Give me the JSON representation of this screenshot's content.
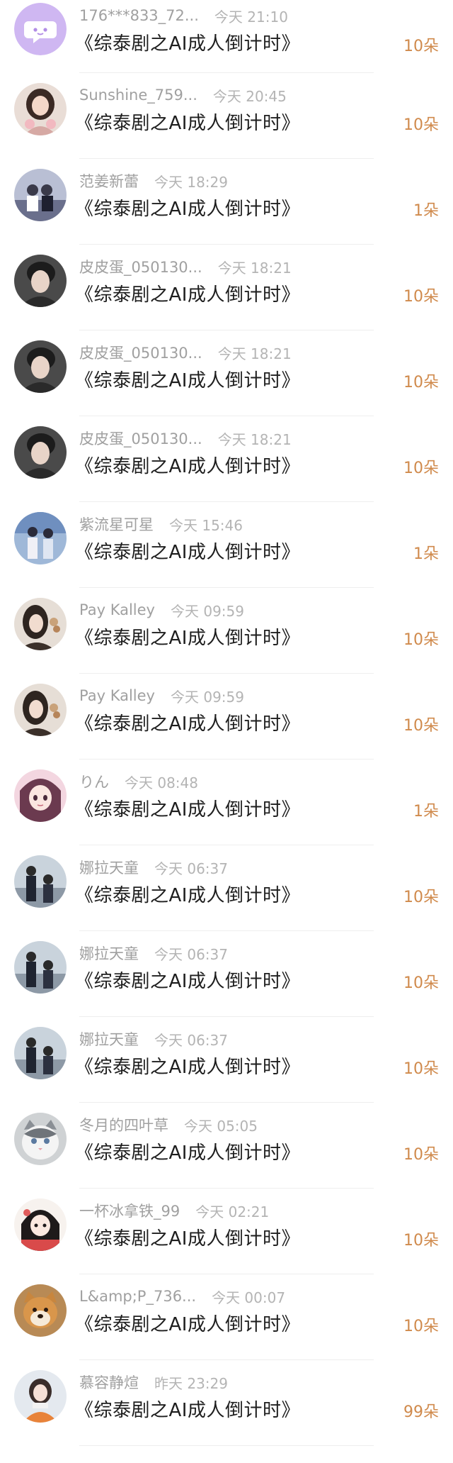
{
  "gift_list": {
    "items": [
      {
        "name": "176***833_72...",
        "time": "今天 21:10",
        "title": "《综泰剧之AI成人倒计时》",
        "amount": "10朵",
        "avatar": "chat-bubble-icon"
      },
      {
        "name": "Sunshine_759...",
        "time": "今天 20:45",
        "title": "《综泰剧之AI成人倒计时》",
        "amount": "10朵",
        "avatar": "girl-photo-avatar"
      },
      {
        "name": "范姜新蕾",
        "time": "今天 18:29",
        "title": "《综泰剧之AI成人倒计时》",
        "amount": "1朵",
        "avatar": "group-photo-avatar"
      },
      {
        "name": "皮皮蛋_050130...",
        "time": "今天 18:21",
        "title": "《综泰剧之AI成人倒计时》",
        "amount": "10朵",
        "avatar": "boy-photo-avatar"
      },
      {
        "name": "皮皮蛋_050130...",
        "time": "今天 18:21",
        "title": "《综泰剧之AI成人倒计时》",
        "amount": "10朵",
        "avatar": "boy-photo-avatar"
      },
      {
        "name": "皮皮蛋_050130...",
        "time": "今天 18:21",
        "title": "《综泰剧之AI成人倒计时》",
        "amount": "10朵",
        "avatar": "boy-photo-avatar"
      },
      {
        "name": "紫流星可星",
        "time": "今天 15:46",
        "title": "《综泰剧之AI成人倒计时》",
        "amount": "1朵",
        "avatar": "couple-photo-avatar"
      },
      {
        "name": "Pay Kalley",
        "time": "今天 09:59",
        "title": "《综泰剧之AI成人倒计时》",
        "amount": "10朵",
        "avatar": "woman-photo-avatar"
      },
      {
        "name": "Pay Kalley",
        "time": "今天 09:59",
        "title": "《综泰剧之AI成人倒计时》",
        "amount": "10朵",
        "avatar": "woman-photo-avatar"
      },
      {
        "name": "りん",
        "time": "今天 08:48",
        "title": "《综泰剧之AI成人倒计时》",
        "amount": "1朵",
        "avatar": "anime-girl-avatar"
      },
      {
        "name": "娜拉天童",
        "time": "今天 06:37",
        "title": "《综泰剧之AI成人倒计时》",
        "amount": "10朵",
        "avatar": "two-men-photo-avatar"
      },
      {
        "name": "娜拉天童",
        "time": "今天 06:37",
        "title": "《综泰剧之AI成人倒计时》",
        "amount": "10朵",
        "avatar": "two-men-photo-avatar"
      },
      {
        "name": "娜拉天童",
        "time": "今天 06:37",
        "title": "《综泰剧之AI成人倒计时》",
        "amount": "10朵",
        "avatar": "two-men-photo-avatar"
      },
      {
        "name": "冬月的四叶草",
        "time": "今天 05:05",
        "title": "《综泰剧之AI成人倒计时》",
        "amount": "10朵",
        "avatar": "cat-photo-avatar"
      },
      {
        "name": "一杯冰拿铁_99",
        "time": "今天 02:21",
        "title": "《综泰剧之AI成人倒计时》",
        "amount": "10朵",
        "avatar": "drawing-girl-avatar"
      },
      {
        "name": "L&amp;P_736...",
        "time": "今天 00:07",
        "title": "《综泰剧之AI成人倒计时》",
        "amount": "10朵",
        "avatar": "dog-photo-avatar"
      },
      {
        "name": "慕容静煊",
        "time": "昨天 23:29",
        "title": "《综泰剧之AI成人倒计时》",
        "amount": "99朵",
        "avatar": "girl-winter-avatar"
      }
    ]
  },
  "colors": {
    "amount": "#d08a4c",
    "meta": "#a5a5a5",
    "title": "#1e1e1e",
    "divider": "#eeeeee"
  }
}
